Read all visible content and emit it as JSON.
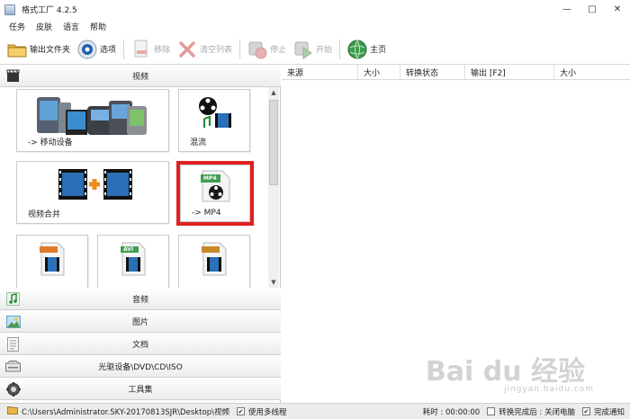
{
  "window": {
    "title": "格式工厂 4.2.5",
    "minimize": "—",
    "maximize": "□",
    "close": "✕"
  },
  "menu": [
    "任务",
    "皮肤",
    "语言",
    "帮助"
  ],
  "toolbar": {
    "output_folder": "输出文件夹",
    "options": "选项",
    "remove": "移除",
    "clear_list": "清空列表",
    "stop": "停止",
    "start": "开始",
    "home": "主页"
  },
  "video_section": {
    "title": "视频",
    "tiles": {
      "mobile": "-> 移动设备",
      "mix": "混流",
      "merge": "视频合并",
      "mp4": "-> MP4",
      "mp4_badge": "MP4",
      "avi_badge": "AVI"
    }
  },
  "categories": {
    "audio": "音频",
    "image": "图片",
    "document": "文档",
    "disc": "光驱设备\\DVD\\CD\\ISO",
    "tools": "工具集"
  },
  "task_table": {
    "columns": [
      "来源",
      "大小",
      "转换状态",
      "输出 [F2]",
      "大小"
    ]
  },
  "statusbar": {
    "path": "C:\\Users\\Administrator.SKY-20170813SJR\\Desktop\\视频",
    "multithread": "使用多线程",
    "elapsed": "耗时 : 00:00:00",
    "after_convert": "转换完成后 : 关闭电脑",
    "notify": "完成通知",
    "multithread_checked": "✔",
    "notify_checked": "✔"
  },
  "watermark": {
    "main": "Bai du 经验",
    "sub": "jingyan.baidu.com"
  },
  "colors": {
    "highlight": "#e02020",
    "accent_orange": "#f08c1c",
    "film_blue": "#2a6fb8"
  }
}
